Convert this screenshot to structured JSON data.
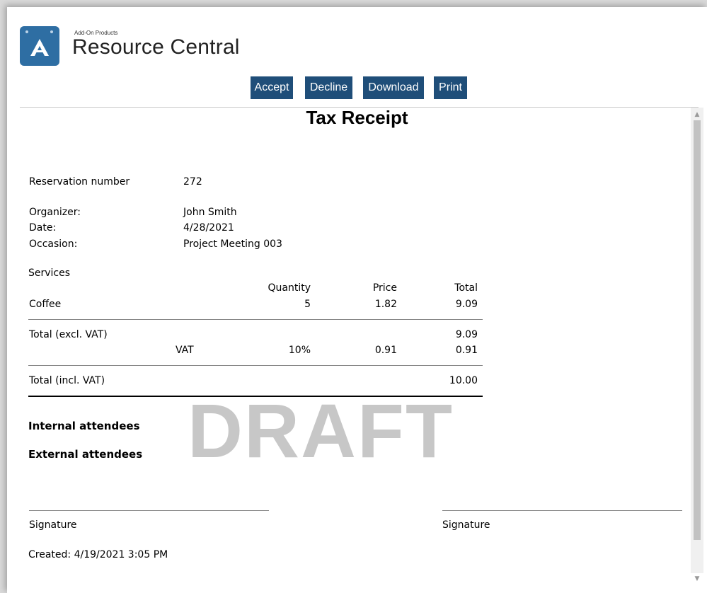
{
  "header": {
    "brand_subtitle": "Add-On Products",
    "brand_title": "Resource Central"
  },
  "toolbar": {
    "accept_label": "Accept",
    "decline_label": "Decline",
    "download_label": "Download",
    "print_label": "Print"
  },
  "document": {
    "title": "Tax Receipt",
    "reservation_label": "Reservation number",
    "reservation_value": "272",
    "organizer_label": "Organizer:",
    "organizer_value": "John Smith",
    "date_label": "Date:",
    "date_value": "4/28/2021",
    "occasion_label": "Occasion:",
    "occasion_value": "Project Meeting 003",
    "services_label": "Services",
    "columns": {
      "quantity": "Quantity",
      "price": "Price",
      "total": "Total"
    },
    "items": [
      {
        "name": "Coffee",
        "quantity": "5",
        "price": "1.82",
        "total": "9.09"
      }
    ],
    "total_excl_label": "Total (excl. VAT)",
    "total_excl_value": "9.09",
    "vat_label": "VAT",
    "vat_rate": "10%",
    "vat_price": "0.91",
    "vat_total": "0.91",
    "total_incl_label": "Total (incl. VAT)",
    "total_incl_value": "10.00",
    "internal_attendees_label": "Internal attendees",
    "external_attendees_label": "External attendees",
    "watermark": "DRAFT",
    "signature_left": "Signature",
    "signature_right": "Signature",
    "created": "Created: 4/19/2021 3:05 PM"
  },
  "colors": {
    "button_bg": "#1f4e79",
    "logo_bg": "#2e6ea3",
    "watermark": "#c7c7c7"
  }
}
